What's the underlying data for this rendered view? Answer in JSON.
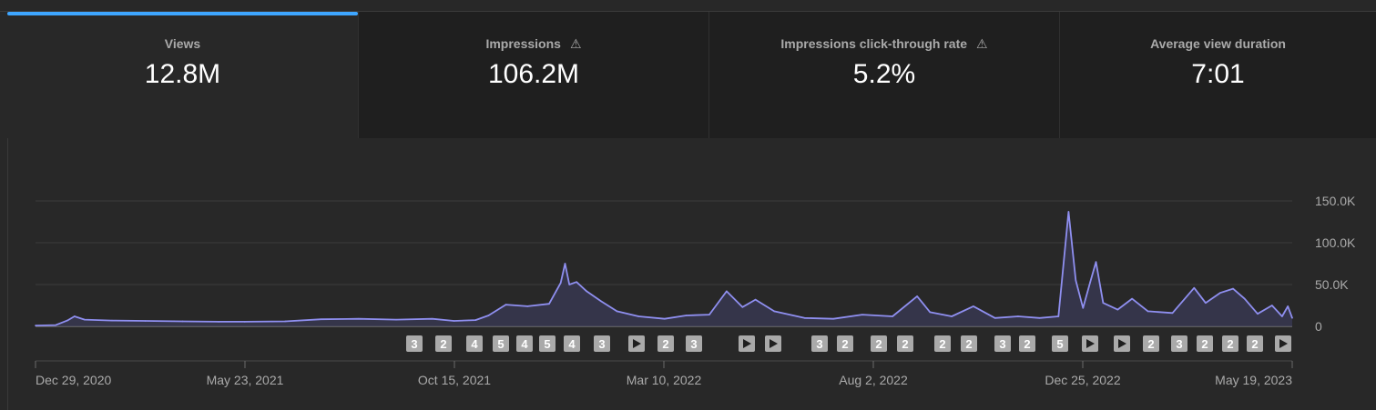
{
  "tabs": [
    {
      "label": "Views",
      "value": "12.8M",
      "warning": false,
      "active": true
    },
    {
      "label": "Impressions",
      "value": "106.2M",
      "warning": true,
      "active": false
    },
    {
      "label": "Impressions click-through rate",
      "value": "5.2%",
      "warning": true,
      "active": false
    },
    {
      "label": "Average view duration",
      "value": "7:01",
      "warning": false,
      "active": false
    }
  ],
  "colors": {
    "line": "#8f8ff0",
    "fill": "#3a3a55",
    "accent": "#3ea6ff",
    "marker_bg": "#aaaaaa"
  },
  "chart_data": {
    "type": "area",
    "x_ticks": [
      "Dec 29, 2020",
      "May 23, 2021",
      "Oct 15, 2021",
      "Mar 10, 2022",
      "Aug 2, 2022",
      "Dec 25, 2022",
      "May 19, 2023"
    ],
    "y_ticks": [
      "150.0K",
      "100.0K",
      "50.0K",
      "0"
    ],
    "ylim": [
      0,
      150000
    ],
    "x_start": "2020-12-29",
    "x_end": "2023-05-19",
    "grid": true,
    "series": [
      {
        "values": [
          [
            "2020-12-29",
            1000
          ],
          [
            "2021-01-12",
            1500
          ],
          [
            "2021-01-20",
            7000
          ],
          [
            "2021-01-25",
            12000
          ],
          [
            "2021-02-01",
            8000
          ],
          [
            "2021-02-20",
            7000
          ],
          [
            "2021-03-15",
            6500
          ],
          [
            "2021-04-10",
            6000
          ],
          [
            "2021-05-05",
            5500
          ],
          [
            "2021-05-23",
            5500
          ],
          [
            "2021-06-20",
            6000
          ],
          [
            "2021-07-15",
            8500
          ],
          [
            "2021-08-10",
            9000
          ],
          [
            "2021-09-05",
            8000
          ],
          [
            "2021-09-30",
            9000
          ],
          [
            "2021-10-15",
            6500
          ],
          [
            "2021-10-30",
            7500
          ],
          [
            "2021-11-08",
            13000
          ],
          [
            "2021-11-20",
            26000
          ],
          [
            "2021-12-05",
            24000
          ],
          [
            "2021-12-20",
            27000
          ],
          [
            "2021-12-28",
            52000
          ],
          [
            "2021-12-31",
            75000
          ],
          [
            "2022-01-03",
            50000
          ],
          [
            "2022-01-08",
            53000
          ],
          [
            "2022-01-15",
            42000
          ],
          [
            "2022-01-25",
            30000
          ],
          [
            "2022-02-05",
            18000
          ],
          [
            "2022-02-20",
            12000
          ],
          [
            "2022-03-10",
            9000
          ],
          [
            "2022-03-25",
            13000
          ],
          [
            "2022-04-10",
            14000
          ],
          [
            "2022-04-22",
            42000
          ],
          [
            "2022-05-03",
            23000
          ],
          [
            "2022-05-12",
            32000
          ],
          [
            "2022-05-25",
            18000
          ],
          [
            "2022-06-15",
            10000
          ],
          [
            "2022-07-05",
            9000
          ],
          [
            "2022-07-25",
            14000
          ],
          [
            "2022-08-15",
            12000
          ],
          [
            "2022-09-01",
            36000
          ],
          [
            "2022-09-10",
            17000
          ],
          [
            "2022-09-25",
            12000
          ],
          [
            "2022-10-10",
            24000
          ],
          [
            "2022-10-25",
            10000
          ],
          [
            "2022-11-10",
            12000
          ],
          [
            "2022-11-25",
            10000
          ],
          [
            "2022-12-08",
            12000
          ],
          [
            "2022-12-15",
            137000
          ],
          [
            "2022-12-20",
            55000
          ],
          [
            "2022-12-25",
            22000
          ],
          [
            "2022-12-30",
            53000
          ],
          [
            "2023-01-03",
            77000
          ],
          [
            "2023-01-08",
            28000
          ],
          [
            "2023-01-18",
            20000
          ],
          [
            "2023-01-28",
            33000
          ],
          [
            "2023-02-08",
            18000
          ],
          [
            "2023-02-25",
            16000
          ],
          [
            "2023-03-12",
            46000
          ],
          [
            "2023-03-20",
            28000
          ],
          [
            "2023-03-30",
            40000
          ],
          [
            "2023-04-08",
            45000
          ],
          [
            "2023-04-16",
            33000
          ],
          [
            "2023-04-25",
            15000
          ],
          [
            "2023-05-05",
            25000
          ],
          [
            "2023-05-12",
            12000
          ],
          [
            "2023-05-16",
            24000
          ],
          [
            "2023-05-19",
            10000
          ]
        ]
      }
    ],
    "markers": [
      "3",
      "2",
      "4",
      "5",
      "4",
      "5",
      "4",
      "3",
      "play",
      "2",
      "3",
      "play",
      "play",
      "3",
      "2",
      "2",
      "2",
      "2",
      "2",
      "3",
      "2",
      "5",
      "play",
      "play",
      "2",
      "3",
      "2",
      "2",
      "2",
      "play"
    ]
  }
}
